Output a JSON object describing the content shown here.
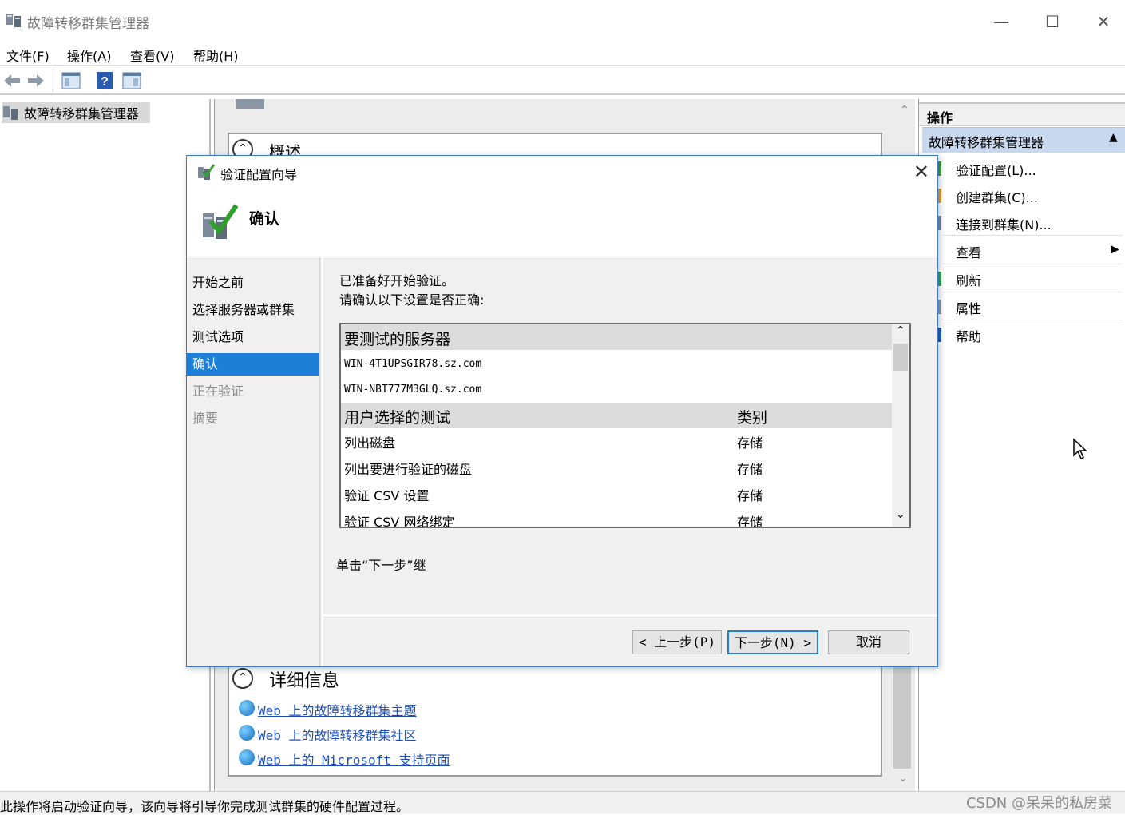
{
  "window": {
    "title": "故障转移群集管理器",
    "minimize": "—",
    "maximize": "☐",
    "close": "✕"
  },
  "menu": [
    "文件(F)",
    "操作(A)",
    "查看(V)",
    "帮助(H)"
  ],
  "tree": {
    "root_label": "故障转移群集管理器"
  },
  "center": {
    "overview_label": "概述",
    "details_label": "详细信息",
    "links": [
      "Web 上的故障转移群集主题",
      "Web 上的故障转移群集社区",
      "Web 上的 Microsoft 支持页面"
    ]
  },
  "actions": {
    "header": "操作",
    "section": "故障转移群集管理器",
    "items": [
      "验证配置(L)...",
      "创建群集(C)...",
      "连接到群集(N)...",
      "查看",
      "刷新",
      "属性",
      "帮助"
    ]
  },
  "status": {
    "text": "此操作将启动验证向导，该向导将引导你完成测试群集的硬件配置过程。",
    "watermark": "CSDN @呆呆的私房菜"
  },
  "dialog": {
    "title": "验证配置向导",
    "heading": "确认",
    "close": "✕",
    "nav": [
      "开始之前",
      "选择服务器或群集",
      "测试选项",
      "确认",
      "正在验证",
      "摘要"
    ],
    "nav_active_index": 3,
    "ready_text": "已准备好开始验证。",
    "confirm_text": "请确认以下设置是否正确:",
    "list": {
      "servers_header": "要测试的服务器",
      "servers": [
        "WIN-4T1UPSGIR78.sz.com",
        "WIN-NBT777M3GLQ.sz.com"
      ],
      "tests_header": "用户选择的测试",
      "category_header": "类别",
      "tests": [
        {
          "name": "列出磁盘",
          "category": "存储"
        },
        {
          "name": "列出要进行验证的磁盘",
          "category": "存储"
        },
        {
          "name": "验证 CSV 设置",
          "category": "存储"
        },
        {
          "name": "验证 CSV 网络绑定",
          "category": "存储"
        }
      ],
      "scroll_up": "⌃",
      "scroll_down": "⌄"
    },
    "click_next_text": "单击“下一步”继",
    "buttons": {
      "back": "< 上一步(P)",
      "next": "下一步(N) >",
      "cancel": "取消"
    }
  }
}
